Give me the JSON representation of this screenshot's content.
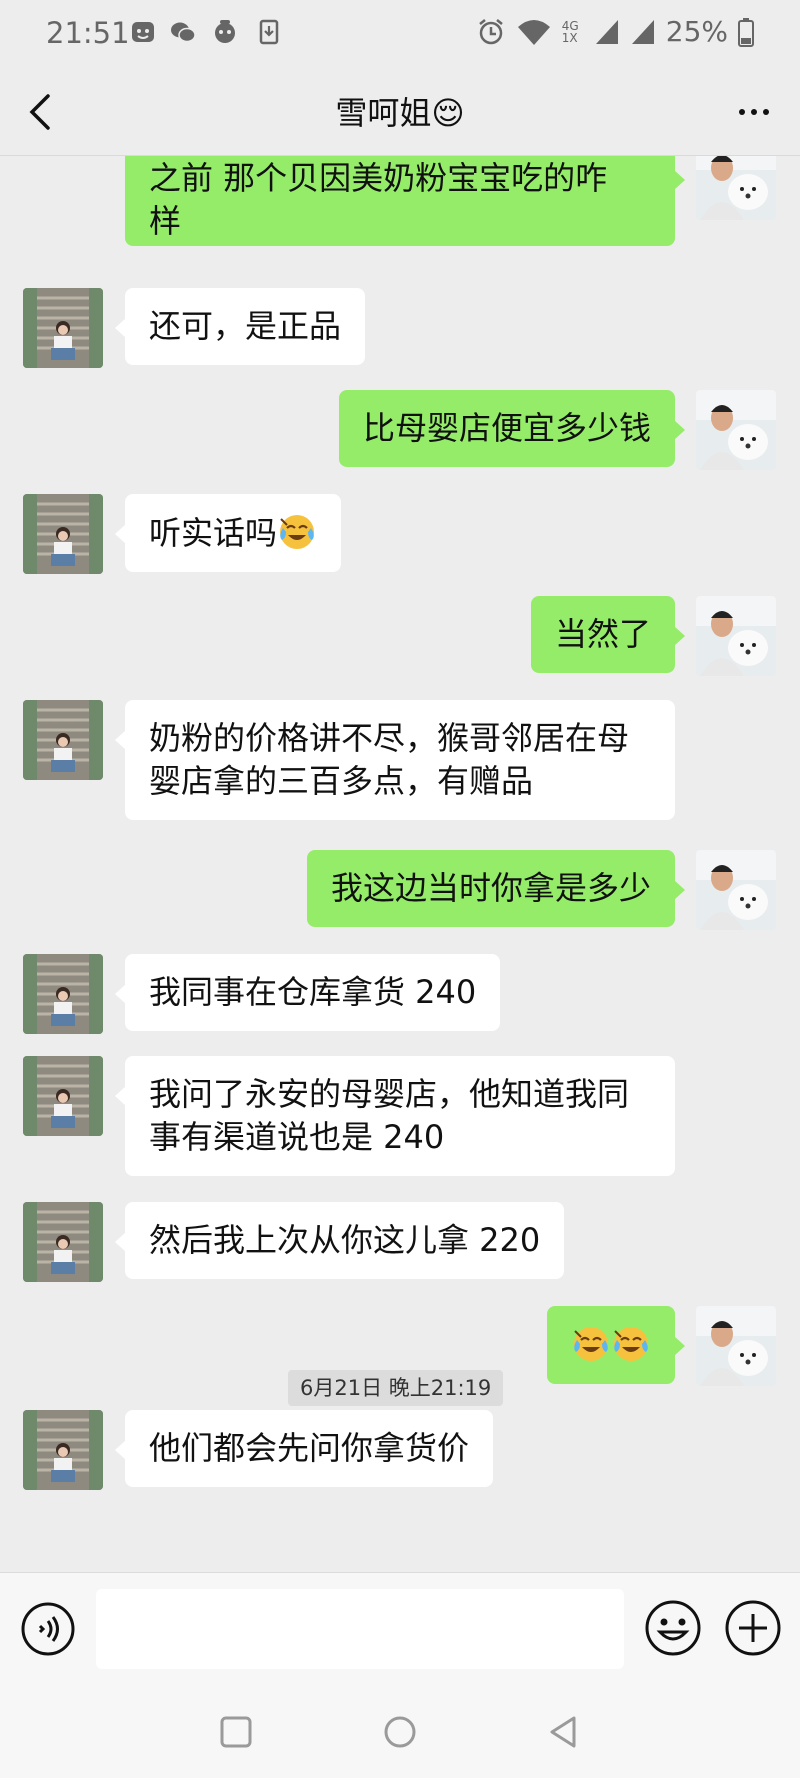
{
  "status_bar": {
    "time": "21:51",
    "network": "4G 1X",
    "battery": "25%"
  },
  "nav": {
    "title": "雪呵姐😌"
  },
  "messages": [
    {
      "side": "out",
      "text": "之前 那个贝因美奶粉宝宝吃的咋\n样"
    },
    {
      "side": "in",
      "text": "还可，是正品"
    },
    {
      "side": "out",
      "text": "比母婴店便宜多少钱"
    },
    {
      "side": "in",
      "text": "听实话吗",
      "emoji": "face-with-tears-of-joy"
    },
    {
      "side": "out",
      "text": "当然了"
    },
    {
      "side": "in",
      "text": "奶粉的价格讲不尽，猴哥邻居在母\n婴店拿的三百多点，有赠品"
    },
    {
      "side": "out",
      "text": "我这边当时你拿是多少"
    },
    {
      "side": "in",
      "text": "我同事在仓库拿货 240"
    },
    {
      "side": "in",
      "text": "我问了永安的母婴店，他知道我同\n事有渠道说也是 240"
    },
    {
      "side": "in",
      "text": "然后我上次从你这儿拿 220"
    },
    {
      "side": "out",
      "text": "",
      "emoji": "face-with-tears-of-joy x2"
    },
    {
      "side": "in",
      "text": "他们都会先问你拿货价"
    }
  ],
  "timestamp": "6月21日 晚上21:19",
  "input": {
    "value": "",
    "placeholder": ""
  },
  "colors": {
    "outgoing_bubble": "#95ec69",
    "incoming_bubble": "#ffffff",
    "background": "#ededed"
  }
}
